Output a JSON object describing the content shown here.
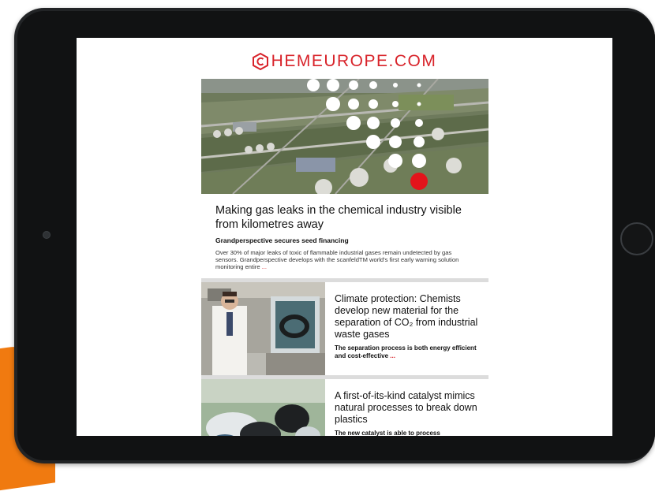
{
  "site": {
    "logo_text": "HEMEUROPE.COM",
    "brand_color": "#d8232a"
  },
  "hero": {
    "title": "Making gas leaks in the chemical industry visible from kilometres away",
    "subtitle": "Grandperspective secures seed financing",
    "body": "Over 30% of major leaks of toxic of flammable industrial gases remain undetected by gas sensors. Grandperspective develops with the scanfeldTM world's first early warning solution monitoring entire",
    "more": "..."
  },
  "articles": [
    {
      "title": "Climate protection: Chemists develop new material for the separation of CO₂ from industrial waste gases",
      "subtitle": "The separation process is both energy efficient and cost-effective",
      "more": "..."
    },
    {
      "title": "A first-of-its-kind catalyst mimics natural processes to break down plastics",
      "subtitle": "The new catalyst is able to process"
    }
  ],
  "colors": {
    "accent_orange": "#f07a10",
    "tablet_frame": "#222426"
  }
}
